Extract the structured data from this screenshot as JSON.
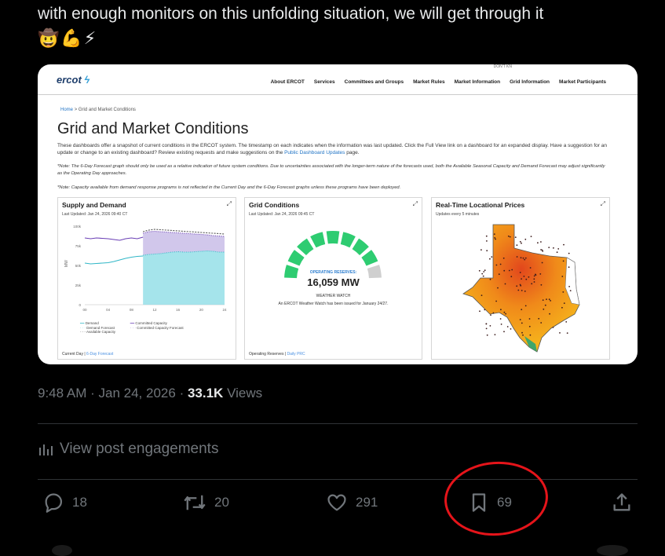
{
  "post": {
    "text": "with enough monitors on this unfolding situation, we will get through it",
    "emojis": "🤠💪⚡"
  },
  "embedded_screenshot": {
    "logo": "ercot",
    "top_link": "DON'T KN",
    "nav": [
      "About ERCOT",
      "Services",
      "Committees and Groups",
      "Market Rules",
      "Market Information",
      "Grid Information",
      "Market Participants"
    ],
    "breadcrumb": {
      "home": "Home",
      "separator": ">",
      "current": "Grid and Market Conditions"
    },
    "title": "Grid and Market Conditions",
    "description": "These dashboards offer a snapshot of current conditions in the ERCOT system. The timestamp on each indicates when the information was last updated. Click the Full View link on a dashboard for an expanded display. Have a suggestion for an update or change to an existing dashboard? Review existing requests and make suggestions on the",
    "description_link": "Public Dashboard Updates",
    "description_end": "page.",
    "note1": "*Note: The 6-Day Forecast graph should only be used as a relative indication of future system conditions. Due to uncertainties associated with the longer-term nature of the forecasts used, both the Available Seasonal Capacity and Demand Forecast may adjust significantly as the Operating Day approaches.",
    "note2": "*Note: Capacity available from demand response programs is not reflected in the Current Day and the 6-Day Forecast graphs unless these programs have been deployed.",
    "panels": {
      "supply": {
        "title": "Supply and Demand",
        "updated": "Last Updated: Jan 24, 2026 09:40 CT",
        "footer_current": "Current Day",
        "footer_sep": "|",
        "footer_link": "6-Day Forecast",
        "ylabel": "MW",
        "legend": [
          "Demand",
          "Committed Capacity",
          "Demand Forecast",
          "Committed Capacity Forecast",
          "Available Capacity"
        ]
      },
      "grid": {
        "title": "Grid Conditions",
        "updated": "Last Updated: Jan 24, 2026 09:45 CT",
        "reserves_label": "OPERATING RESERVES:",
        "reserves_value": "16,059 MW",
        "status": "WEATHER WATCH",
        "message": "An ERCOT Weather Watch has been issued for January 24/27.",
        "footer_current": "Operating Reserves",
        "footer_sep": "|",
        "footer_link": "Daily PRC"
      },
      "prices": {
        "title": "Real-Time Locational Prices",
        "updated": "Updates every 5 minutes"
      }
    }
  },
  "chart_data": {
    "type": "area",
    "x_ticks": [
      "00",
      "04",
      "08",
      "12",
      "16",
      "20",
      "24"
    ],
    "y_ticks": [
      "100k",
      "75k",
      "50k",
      "25k",
      "0"
    ],
    "ylim": [
      0,
      100000
    ],
    "xlim": [
      0,
      24
    ],
    "series": [
      {
        "name": "Committed Capacity",
        "color": "#6a3fb5",
        "x": [
          0,
          1,
          2,
          3,
          4,
          5,
          6,
          7,
          8,
          9,
          10
        ],
        "values": [
          85000,
          84000,
          85000,
          84500,
          84000,
          83000,
          82000,
          84000,
          85000,
          84000,
          86000
        ]
      },
      {
        "name": "Committed Capacity Forecast",
        "color": "#6a3fb5",
        "x": [
          10,
          11,
          12,
          13,
          14,
          15,
          16,
          17,
          18,
          19,
          20,
          21,
          22,
          23,
          24
        ],
        "values": [
          91000,
          93000,
          93500,
          93000,
          92500,
          92000,
          91500,
          91000,
          90500,
          90000,
          89500,
          89000,
          88000,
          87500,
          87000
        ]
      },
      {
        "name": "Demand",
        "color": "#31b7c7",
        "x": [
          0,
          1,
          2,
          3,
          4,
          5,
          6,
          7,
          8,
          9,
          10
        ],
        "values": [
          53000,
          52000,
          52500,
          53000,
          53500,
          55000,
          57000,
          59000,
          60500,
          61500,
          62000
        ]
      },
      {
        "name": "Demand Forecast",
        "color": "#31b7c7",
        "x": [
          10,
          11,
          12,
          13,
          14,
          15,
          16,
          17,
          18,
          19,
          20,
          21,
          22,
          23,
          24
        ],
        "values": [
          63000,
          64000,
          64500,
          65000,
          66000,
          67000,
          67500,
          67000,
          67000,
          67500,
          68000,
          68500,
          68000,
          67000,
          67000
        ]
      },
      {
        "name": "Available Capacity",
        "color": "#555555",
        "x": [
          10,
          11,
          12,
          13,
          14,
          15,
          16,
          17,
          18,
          19,
          20,
          21,
          22,
          23,
          24
        ],
        "values": [
          93000,
          95000,
          96000,
          95500,
          95000,
          94500,
          94000,
          93500,
          93000,
          92500,
          92000,
          91500,
          91000,
          90500,
          90000
        ]
      }
    ]
  },
  "gauge": {
    "segments": 9,
    "active": 8,
    "active_color": "#2ecc71",
    "inactive_color": "#cfcfcf"
  },
  "tweet_meta": {
    "time": "9:48 AM",
    "dot": "·",
    "date": "Jan 24, 2026",
    "views_count": "33.1K",
    "views_label": "Views",
    "engagements": "View post engagements"
  },
  "actions": {
    "replies": "18",
    "reposts": "20",
    "likes": "291",
    "bookmarks": "69"
  },
  "colors": {
    "annotation_circle": "#e5141a",
    "muted": "#71767b"
  }
}
